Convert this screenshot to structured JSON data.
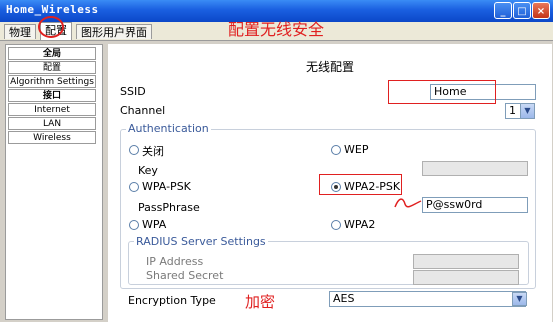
{
  "window": {
    "title": "Home_Wireless",
    "minimize": "_",
    "maximize": "□",
    "close": "×"
  },
  "tabs": [
    {
      "label": "物理"
    },
    {
      "label": "配置"
    },
    {
      "label": "图形用户界面"
    }
  ],
  "annotations": {
    "title": "配置无线安全",
    "encryption": "加密"
  },
  "sidebar": {
    "items": [
      {
        "label": "全局"
      },
      {
        "label": "配置"
      },
      {
        "label": "Algorithm Settings"
      },
      {
        "label": "接口"
      },
      {
        "label": "Internet"
      },
      {
        "label": "LAN"
      },
      {
        "label": "Wireless"
      }
    ]
  },
  "panel": {
    "title": "无线配置",
    "ssid": {
      "label": "SSID",
      "value": "Home"
    },
    "channel": {
      "label": "Channel",
      "value": "1"
    },
    "authentication": {
      "legend": "Authentication",
      "options": {
        "off": "关闭",
        "wep": "WEP",
        "wpa_psk": "WPA-PSK",
        "wpa2_psk": "WPA2-PSK",
        "wpa": "WPA",
        "wpa2": "WPA2"
      },
      "selected": "WPA2-PSK",
      "key_label": "Key",
      "key_value": "",
      "passphrase_label": "PassPhrase",
      "passphrase_value": "P@ssw0rd"
    },
    "radius": {
      "legend": "RADIUS Server Settings",
      "ip_label": "IP Address",
      "secret_label": "Shared Secret"
    },
    "encryption": {
      "label": "Encryption Type",
      "value": "AES"
    }
  },
  "colors": {
    "annotation": "#e02020",
    "titlebar": "#0b47c8",
    "group_legend": "#3a5a9a"
  }
}
